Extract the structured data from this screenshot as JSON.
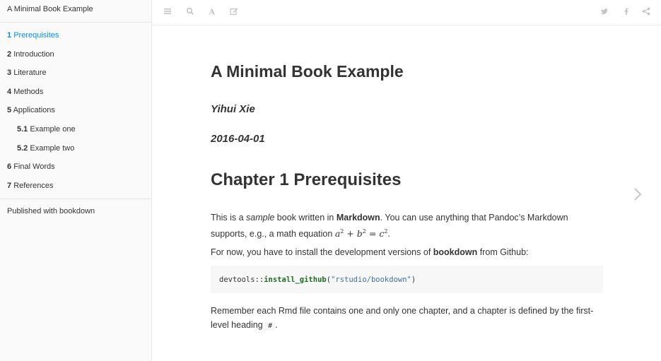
{
  "sidebar": {
    "title": "A Minimal Book Example",
    "items": [
      {
        "num": "1",
        "label": "Prerequisites"
      },
      {
        "num": "2",
        "label": "Introduction"
      },
      {
        "num": "3",
        "label": "Literature"
      },
      {
        "num": "4",
        "label": "Methods"
      },
      {
        "num": "5",
        "label": "Applications"
      },
      {
        "num": "5.1",
        "label": "Example one"
      },
      {
        "num": "5.2",
        "label": "Example two"
      },
      {
        "num": "6",
        "label": "Final Words"
      },
      {
        "num": "7",
        "label": "References"
      }
    ],
    "footer": "Published with bookdown"
  },
  "toolbar": {
    "left_icons": [
      "menu-icon",
      "search-icon",
      "font-icon",
      "edit-icon"
    ],
    "right_icons": [
      "twitter-icon",
      "facebook-icon",
      "share-icon"
    ]
  },
  "content": {
    "title": "A Minimal Book Example",
    "author": "Yihui Xie",
    "date": "2016-04-01",
    "chapter_heading": "Chapter 1 Prerequisites",
    "p1": {
      "t1": "This is a ",
      "em": "sample",
      "t2": " book written in ",
      "strong": "Markdown",
      "t3": ". You can use anything that Pandoc’s Markdown supports, e.g., a math equation ",
      "math_a": "a",
      "math_b": "b",
      "math_c": "c",
      "math_exp": "2",
      "math_plus": " + ",
      "math_eq": " = ",
      "t4": "."
    },
    "p2": {
      "t1": "For now, you have to install the development versions of ",
      "strong": "bookdown",
      "t2": " from Github:"
    },
    "code": {
      "prefix": "devtools::",
      "fn": "install_github",
      "open": "(",
      "str": "\"rstudio/bookdown\"",
      "close": ")"
    },
    "p3": {
      "t1": "Remember each Rmd file contains one and only one chapter, and a chapter is defined by the first-level heading ",
      "code": "#",
      "t2": "."
    }
  },
  "colors": {
    "accent": "#008cff",
    "icon": "#c3c3c3",
    "text": "#333333",
    "sidebar_bg": "#fafafa"
  }
}
